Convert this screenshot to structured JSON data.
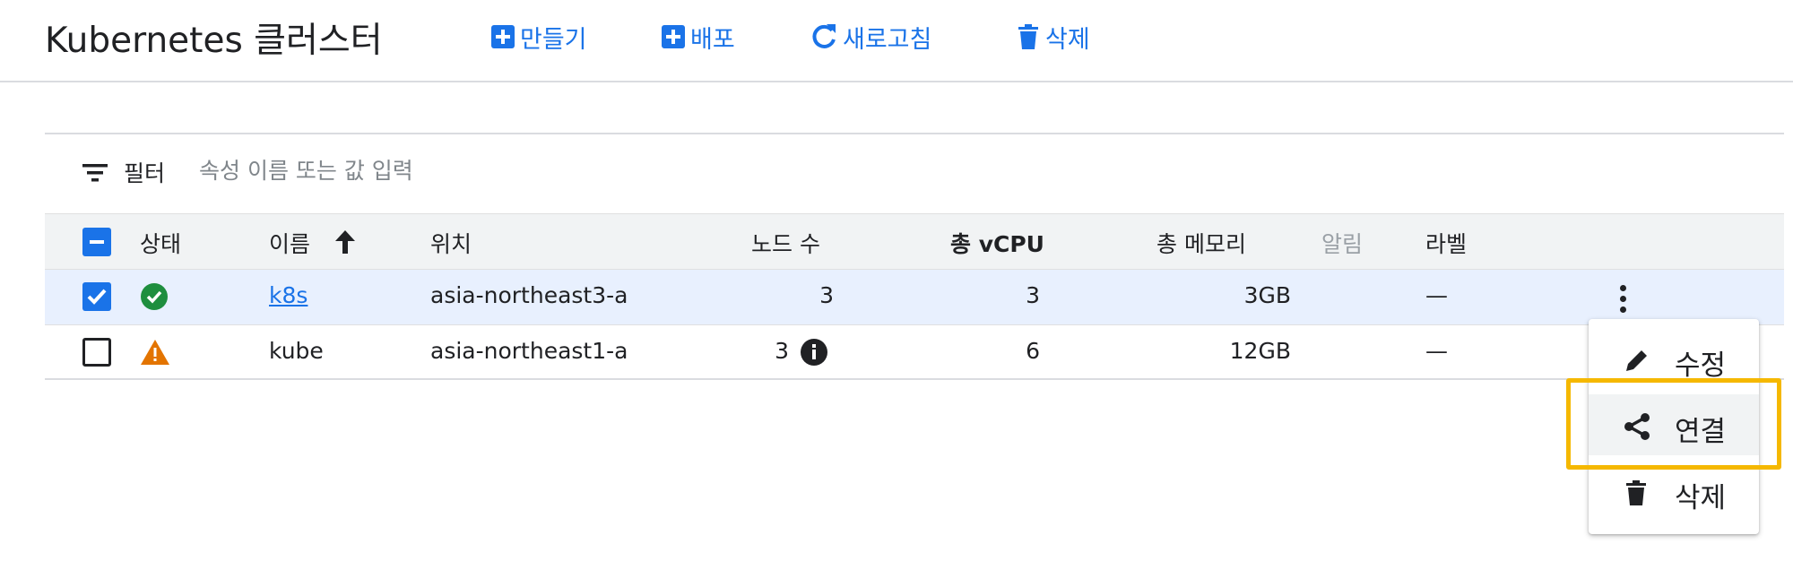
{
  "header": {
    "title": "Kubernetes 클러스터",
    "actions": {
      "create": "만들기",
      "deploy": "배포",
      "refresh": "새로고침",
      "delete": "삭제"
    }
  },
  "filter": {
    "label": "필터",
    "placeholder": "속성 이름 또는 값 입력"
  },
  "table": {
    "columns": {
      "status": "상태",
      "name": "이름",
      "location": "위치",
      "nodes": "노드 수",
      "vcpu": "총 vCPU",
      "memory": "총 메모리",
      "alerts": "알림",
      "labels": "라벨"
    },
    "rows": [
      {
        "checked": true,
        "status": "ok",
        "name": "k8s",
        "location": "asia-northeast3-a",
        "nodes": "3",
        "vcpu": "3",
        "memory": "3GB",
        "labels": "—"
      },
      {
        "checked": false,
        "status": "warning",
        "name": "kube",
        "location": "asia-northeast1-a",
        "nodes": "3",
        "vcpu": "6",
        "memory": "12GB",
        "labels": "—"
      }
    ]
  },
  "row_menu": {
    "items": {
      "edit": "수정",
      "connect": "연결",
      "delete": "삭제"
    }
  },
  "colors": {
    "accent": "#1a73e8",
    "ok": "#1e8e3e",
    "warning": "#e37400",
    "highlight": "#f5b800"
  }
}
